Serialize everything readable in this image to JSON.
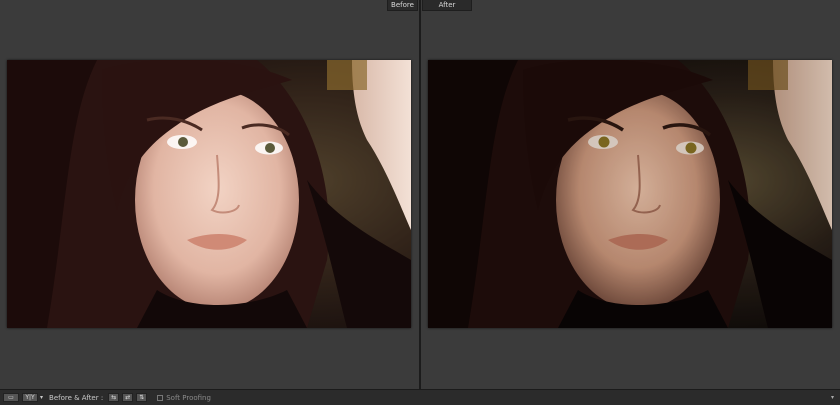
{
  "view": {
    "before_label": "Before",
    "after_label": "After"
  },
  "toolbar": {
    "before_after_label": "Before & After :",
    "soft_proofing_label": "Soft Proofing",
    "loupe_icon": "loupe-view-icon",
    "yy_label": "Y|Y",
    "menu_arrow": "▾"
  },
  "colors": {
    "workspace": "#3b3b3b",
    "toolbar": "#2b2b2b",
    "divider": "#1c1c1c"
  }
}
